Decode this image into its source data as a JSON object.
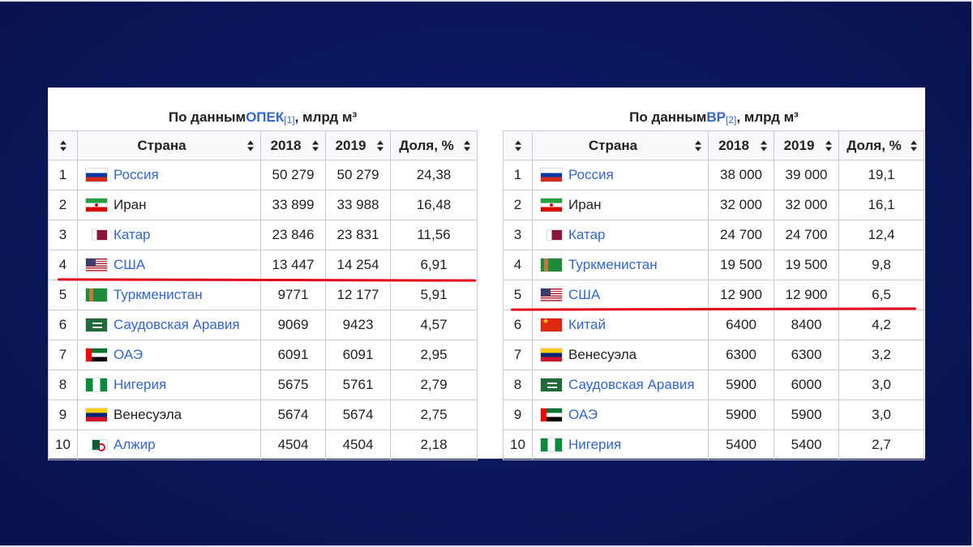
{
  "left_table": {
    "caption_prefix": "По данным ",
    "caption_source": "ОПЕК",
    "caption_ref": "[1]",
    "caption_suffix": ", млрд м³",
    "headers": [
      "Страна",
      "2018",
      "2019",
      "Доля, %"
    ],
    "rows": [
      {
        "rank": "1",
        "country": "Россия",
        "flag": "russia-flag",
        "y2018": "50 279",
        "y2019": "50 279",
        "share": "24,38"
      },
      {
        "rank": "2",
        "country": "Иран",
        "flag": "iran-flag",
        "y2018": "33 899",
        "y2019": "33 988",
        "share": "16,48"
      },
      {
        "rank": "3",
        "country": "Катар",
        "flag": "qatar-flag",
        "y2018": "23 846",
        "y2019": "23 831",
        "share": "11,56"
      },
      {
        "rank": "4",
        "country": "США",
        "flag": "usa-flag",
        "y2018": "13 447",
        "y2019": "14 254",
        "share": "6,91"
      },
      {
        "rank": "5",
        "country": "Туркменистан",
        "flag": "turkmenistan-flag",
        "y2018": "9771",
        "y2019": "12 177",
        "share": "5,91"
      },
      {
        "rank": "6",
        "country": "Саудовская Аравия",
        "flag": "saudi-arabia-flag",
        "y2018": "9069",
        "y2019": "9423",
        "share": "4,57"
      },
      {
        "rank": "7",
        "country": "ОАЭ",
        "flag": "uae-flag",
        "y2018": "6091",
        "y2019": "6091",
        "share": "2,95"
      },
      {
        "rank": "8",
        "country": "Нигерия",
        "flag": "nigeria-flag",
        "y2018": "5675",
        "y2019": "5761",
        "share": "2,79"
      },
      {
        "rank": "9",
        "country": "Венесуэла",
        "flag": "venezuela-flag",
        "y2018": "5674",
        "y2019": "5674",
        "share": "2,75"
      },
      {
        "rank": "10",
        "country": "Алжир",
        "flag": "algeria-flag",
        "y2018": "4504",
        "y2019": "4504",
        "share": "2,18"
      }
    ]
  },
  "right_table": {
    "caption_prefix": "По данным ",
    "caption_source": "BP",
    "caption_ref": "[2]",
    "caption_suffix": ", млрд м³",
    "headers": [
      "Страна",
      "2018",
      "2019",
      "Доля, %"
    ],
    "rows": [
      {
        "rank": "1",
        "country": "Россия",
        "flag": "russia-flag",
        "y2018": "38 000",
        "y2019": "39 000",
        "share": "19,1"
      },
      {
        "rank": "2",
        "country": "Иран",
        "flag": "iran-flag",
        "y2018": "32 000",
        "y2019": "32 000",
        "share": "16,1"
      },
      {
        "rank": "3",
        "country": "Катар",
        "flag": "qatar-flag",
        "y2018": "24 700",
        "y2019": "24 700",
        "share": "12,4"
      },
      {
        "rank": "4",
        "country": "Туркменистан",
        "flag": "turkmenistan-flag",
        "y2018": "19 500",
        "y2019": "19 500",
        "share": "9,8"
      },
      {
        "rank": "5",
        "country": "США",
        "flag": "usa-flag",
        "y2018": "12 900",
        "y2019": "12 900",
        "share": "6,5"
      },
      {
        "rank": "6",
        "country": "Китай",
        "flag": "china-flag",
        "y2018": "6400",
        "y2019": "8400",
        "share": "4,2"
      },
      {
        "rank": "7",
        "country": "Венесуэла",
        "flag": "venezuela-flag",
        "y2018": "6300",
        "y2019": "6300",
        "share": "3,2"
      },
      {
        "rank": "8",
        "country": "Саудовская Аравия",
        "flag": "saudi-arabia-flag",
        "y2018": "5900",
        "y2019": "6000",
        "share": "3,0"
      },
      {
        "rank": "9",
        "country": "ОАЭ",
        "flag": "uae-flag",
        "y2018": "5900",
        "y2019": "5900",
        "share": "3,0"
      },
      {
        "rank": "10",
        "country": "Нигерия",
        "flag": "nigeria-flag",
        "y2018": "5400",
        "y2019": "5400",
        "share": "2,7"
      }
    ]
  },
  "colors": {
    "link": "#3366cc",
    "highlight_line": "#e3001b",
    "background": "#0a175a"
  }
}
